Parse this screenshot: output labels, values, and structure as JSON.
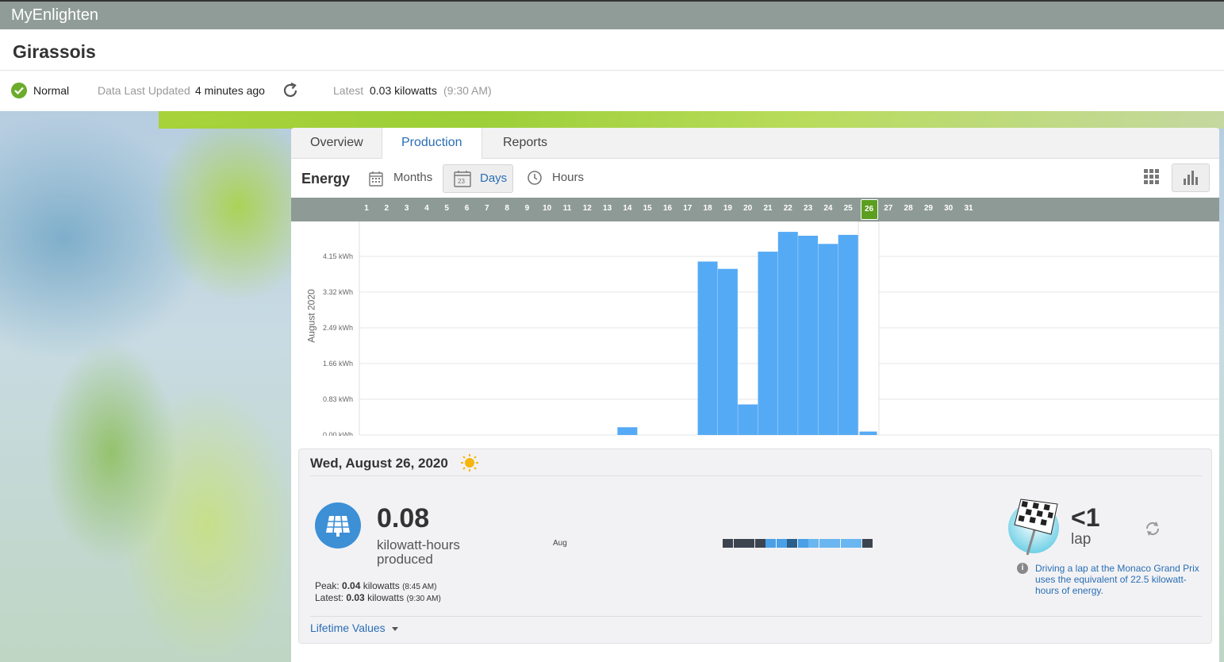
{
  "app": {
    "brand": "MyEnlighten"
  },
  "site": {
    "name": "Girassois"
  },
  "status": {
    "state": "Normal",
    "updated_label": "Data Last Updated",
    "updated_value": "4 minutes ago",
    "latest_label": "Latest",
    "latest_value": "0.03 kilowatts",
    "latest_time": "(9:30 AM)"
  },
  "tabs": [
    {
      "label": "Overview"
    },
    {
      "label": "Production"
    },
    {
      "label": "Reports"
    }
  ],
  "toolbar": {
    "energy_label": "Energy",
    "months_label": "Months",
    "days_label": "Days",
    "hours_label": "Hours",
    "calendar_num": "23"
  },
  "colors": {
    "bar": "#55aaf5",
    "accent": "#2a6eb5",
    "selected_day": "#5c9e1f"
  },
  "day_axis": {
    "days": [
      "1",
      "2",
      "3",
      "4",
      "5",
      "6",
      "7",
      "8",
      "9",
      "10",
      "11",
      "12",
      "13",
      "14",
      "15",
      "16",
      "17",
      "18",
      "19",
      "20",
      "21",
      "22",
      "23",
      "24",
      "25",
      "26",
      "27",
      "28",
      "29",
      "30",
      "31"
    ],
    "selected": "26"
  },
  "chart_data": {
    "type": "bar",
    "ylabel": "August 2020",
    "y_ticks": [
      "0.00 kWh",
      "0.83 kWh",
      "1.66 kWh",
      "2.49 kWh",
      "3.32 kWh",
      "4.15 kWh"
    ],
    "ylim": [
      0,
      4.98
    ],
    "categories": [
      "1",
      "2",
      "3",
      "4",
      "5",
      "6",
      "7",
      "8",
      "9",
      "10",
      "11",
      "12",
      "13",
      "14",
      "15",
      "16",
      "17",
      "18",
      "19",
      "20",
      "21",
      "22",
      "23",
      "24",
      "25",
      "26",
      "27",
      "28",
      "29",
      "30",
      "31"
    ],
    "values": [
      0,
      0,
      0,
      0,
      0,
      0,
      0,
      0,
      0,
      0,
      0,
      0,
      0,
      0.18,
      0,
      0,
      0,
      4.03,
      3.86,
      0.71,
      4.26,
      4.72,
      4.63,
      4.44,
      4.65,
      0.08,
      0,
      0,
      0,
      0,
      0
    ],
    "grid": true
  },
  "detail": {
    "date": "Wed, August 26, 2020",
    "produced_value": "0.08",
    "produced_unit": "kilowatt-hours produced",
    "peak_label": "Peak:",
    "peak_value": "0.04",
    "peak_unit": "kilowatts",
    "peak_time": "(8:45 AM)",
    "latest_label": "Latest:",
    "latest_value": "0.03",
    "latest_unit": "kilowatts",
    "latest_time": "(9:30 AM)",
    "month_label": "Aug",
    "heat_colors": [
      "#3c4450",
      "#3c4450",
      "#3c4450",
      "#3c4450",
      "#4aa0e6",
      "#4aa0e6",
      "#2a5f8a",
      "#4aa0e6",
      "#6ab6f0",
      "#6ab6f0",
      "#6ab6f0",
      "#6ab6f0",
      "#6ab6f0",
      "#3c4450"
    ],
    "lap_value": "<1",
    "lap_unit": "lap",
    "fact": "Driving a lap at the Monaco Grand Prix uses the equivalent of 22.5 kilowatt-hours of energy.",
    "lifetime_label": "Lifetime Values"
  }
}
